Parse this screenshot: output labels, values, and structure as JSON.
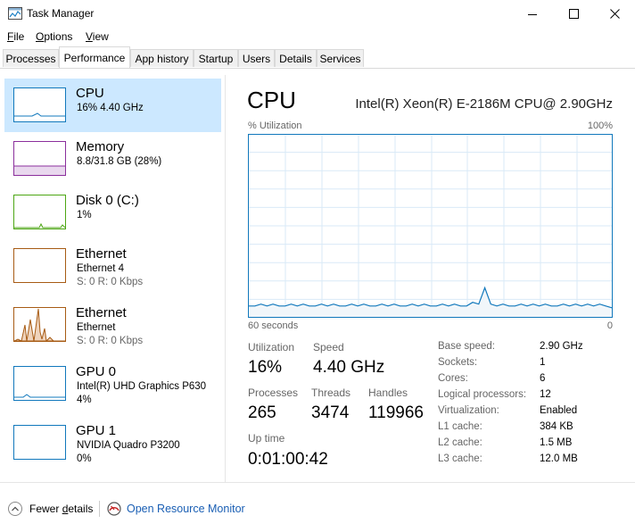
{
  "window": {
    "title": "Task Manager"
  },
  "menu": [
    {
      "label": "File",
      "accel": "F",
      "rest": "ile"
    },
    {
      "label": "Options",
      "accel": "O",
      "rest": "ptions"
    },
    {
      "label": "View",
      "accel": "V",
      "rest": "iew"
    }
  ],
  "tabs": [
    "Processes",
    "Performance",
    "App history",
    "Startup",
    "Users",
    "Details",
    "Services"
  ],
  "active_tab": "Performance",
  "sidebar": [
    {
      "name": "CPU",
      "sub1": "16% 4.40 GHz",
      "color": "#1178bc"
    },
    {
      "name": "Memory",
      "sub1": "8.8/31.8 GB (28%)",
      "color": "#8b2f9c"
    },
    {
      "name": "Disk 0 (C:)",
      "sub1": "1%",
      "color": "#4da614"
    },
    {
      "name": "Ethernet",
      "sub1": "Ethernet 4",
      "sub2": "S: 0 R: 0 Kbps",
      "color": "#a75b14"
    },
    {
      "name": "Ethernet",
      "sub1": "Ethernet",
      "sub2": "S: 0 R: 0 Kbps",
      "color": "#a75b14"
    },
    {
      "name": "GPU 0",
      "sub1": "Intel(R) UHD Graphics P630",
      "sub2": "4%",
      "color": "#1178bc"
    },
    {
      "name": "GPU 1",
      "sub1": "NVIDIA Quadro P3200",
      "sub2": "0%",
      "color": "#1178bc"
    }
  ],
  "main": {
    "title": "CPU",
    "model": "Intel(R) Xeon(R) E-2186M CPU@ 2.90GHz",
    "graph_label": "% Utilization",
    "graph_max": "100%",
    "graph_span": "60 seconds",
    "graph_min": "0",
    "graph_color": "#1178bc",
    "utilization_series": [
      6,
      6,
      7,
      6,
      7,
      6,
      6,
      7,
      6,
      7,
      6,
      6,
      7,
      6,
      7,
      6,
      6,
      7,
      6,
      7,
      6,
      6,
      7,
      6,
      7,
      6,
      6,
      7,
      6,
      7,
      6,
      6,
      7,
      6,
      7,
      6,
      6,
      8,
      7,
      16,
      7,
      6,
      7,
      6,
      6,
      7,
      6,
      7,
      6,
      7,
      6,
      6,
      7,
      6,
      7,
      6,
      7,
      6,
      7,
      6,
      5
    ]
  },
  "stats": {
    "utilization": {
      "label": "Utilization",
      "value": "16%"
    },
    "speed": {
      "label": "Speed",
      "value": "4.40 GHz"
    },
    "processes": {
      "label": "Processes",
      "value": "265"
    },
    "threads": {
      "label": "Threads",
      "value": "3474"
    },
    "handles": {
      "label": "Handles",
      "value": "119966"
    },
    "uptime": {
      "label": "Up time",
      "value": "0:01:00:42"
    }
  },
  "specs": [
    {
      "label": "Base speed:",
      "value": "2.90 GHz"
    },
    {
      "label": "Sockets:",
      "value": "1"
    },
    {
      "label": "Cores:",
      "value": "6"
    },
    {
      "label": "Logical processors:",
      "value": "12"
    },
    {
      "label": "Virtualization:",
      "value": "Enabled"
    },
    {
      "label": "L1 cache:",
      "value": "384 KB"
    },
    {
      "label": "L2 cache:",
      "value": "1.5 MB"
    },
    {
      "label": "L3 cache:",
      "value": "12.0 MB"
    }
  ],
  "footer": {
    "fewer_details": {
      "before": "Fewer ",
      "accel": "d",
      "after": "etails"
    },
    "open_resource_monitor": "Open Resource Monitor"
  }
}
